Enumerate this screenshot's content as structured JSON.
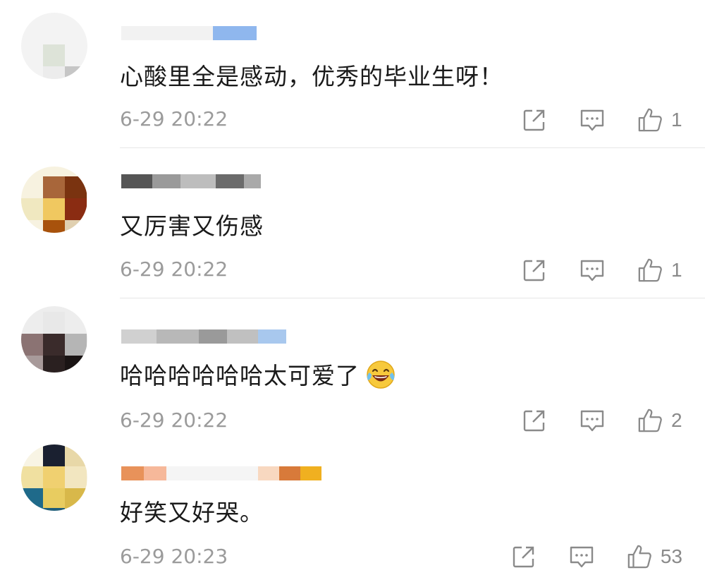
{
  "comments": [
    {
      "text": "心酸里全是感动，优秀的毕业生呀！",
      "time": "6-29 20:22",
      "likes": "1"
    },
    {
      "text": "又厉害又伤感",
      "time": "6-29 20:22",
      "likes": "1"
    },
    {
      "text": "哈哈哈哈哈哈太可爱了",
      "emoji": "laughing-tears-icon",
      "time": "6-29 20:22",
      "likes": "2"
    },
    {
      "text": "好笑又好哭。",
      "time": "6-29 20:23",
      "likes": "53"
    }
  ],
  "icons": {
    "repost": "repost-icon",
    "comment": "comment-icon",
    "like": "like-icon"
  },
  "colors": {
    "text": "#1a1a1a",
    "meta": "#9b9b9b",
    "icon": "#8a8a8a",
    "divider": "#e6e6e6"
  }
}
